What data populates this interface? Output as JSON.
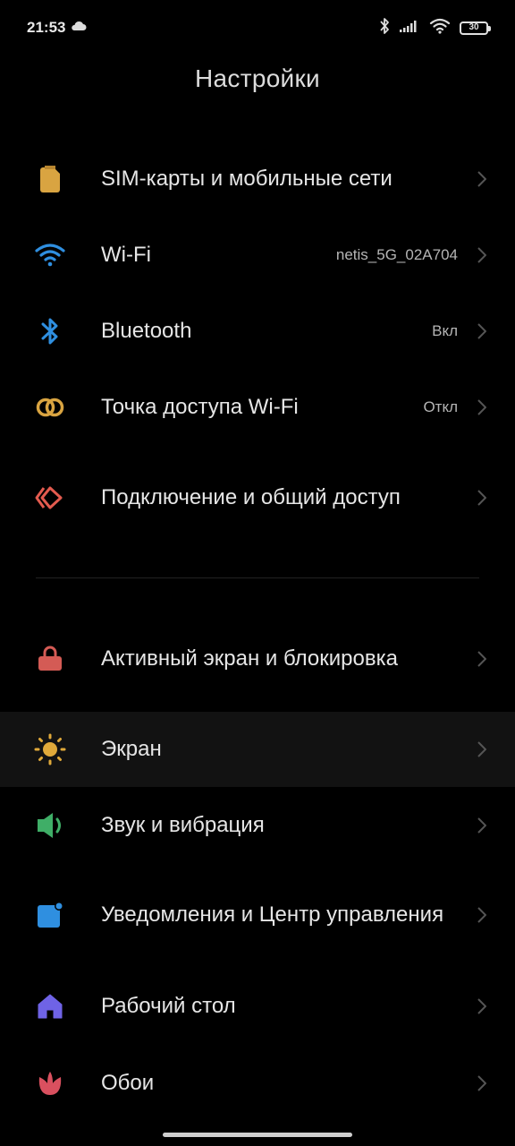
{
  "status_bar": {
    "time": "21:53",
    "battery_level": "30"
  },
  "header": {
    "title": "Настройки"
  },
  "items": [
    {
      "label": "SIM-карты и мобильные сети",
      "value": "",
      "icon": "sim-card-icon",
      "icon_color": "#d9a441"
    },
    {
      "label": "Wi-Fi",
      "value": "netis_5G_02A704",
      "icon": "wifi-icon",
      "icon_color": "#2f8fe0"
    },
    {
      "label": "Bluetooth",
      "value": "Вкл",
      "icon": "bluetooth-icon",
      "icon_color": "#2f8fe0"
    },
    {
      "label": "Точка доступа Wi-Fi",
      "value": "Откл",
      "icon": "hotspot-icon",
      "icon_color": "#d9a441"
    },
    {
      "label": "Подключение и общий доступ",
      "value": "",
      "icon": "connection-sharing-icon",
      "icon_color": "#e35b4f"
    },
    {
      "label": "Активный экран и блокировка",
      "value": "",
      "icon": "lock-icon",
      "icon_color": "#d45b55"
    },
    {
      "label": "Экран",
      "value": "",
      "icon": "brightness-icon",
      "icon_color": "#e0a93a"
    },
    {
      "label": "Звук и вибрация",
      "value": "",
      "icon": "speaker-icon",
      "icon_color": "#3fae67"
    },
    {
      "label": "Уведомления и Центр управления",
      "value": "",
      "icon": "notification-icon",
      "icon_color": "#2f8fe0"
    },
    {
      "label": "Рабочий стол",
      "value": "",
      "icon": "home-icon",
      "icon_color": "#6f63e6"
    },
    {
      "label": "Обои",
      "value": "",
      "icon": "wallpaper-flower-icon",
      "icon_color": "#d9505f"
    }
  ]
}
